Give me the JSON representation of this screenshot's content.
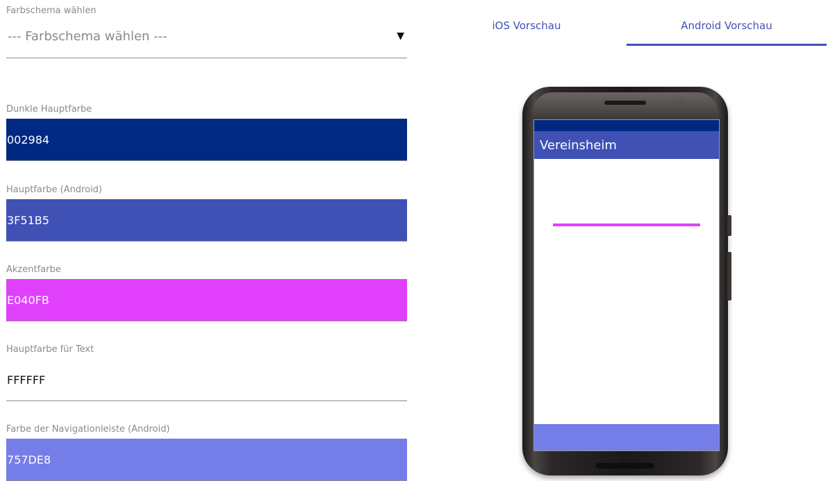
{
  "form": {
    "scheme": {
      "label": "Farbschema wählen",
      "value": "--- Farbschema wählen ---",
      "arrow_icon": "triangle-down"
    },
    "fields": [
      {
        "label": "Dunkle Hauptfarbe",
        "value": "002984",
        "color": "#002984"
      },
      {
        "label": "Hauptfarbe (Android)",
        "value": "3F51B5",
        "color": "#3F51B5"
      },
      {
        "label": "Akzentfarbe",
        "value": "E040FB",
        "color": "#E040FB"
      },
      {
        "label": "Hauptfarbe für Text",
        "value": "FFFFFF",
        "color": "#FFFFFF"
      },
      {
        "label": "Farbe der Navigationleiste (Android)",
        "value": "757DE8",
        "color": "#757DE8"
      }
    ]
  },
  "tabs": [
    {
      "label": "iOS Vorschau",
      "active": false
    },
    {
      "label": "Android Vorschau",
      "active": true
    }
  ],
  "preview": {
    "app_title": "Vereinsheim",
    "status_bar_color": "#002984",
    "app_bar_color": "#3F51B5",
    "accent_color": "#E040FB",
    "text_color": "#FFFFFF",
    "nav_bar_color": "#757DE8"
  },
  "colors": {
    "tab_accent": "#3F51B5",
    "label_gray": "#8A8A8A"
  }
}
